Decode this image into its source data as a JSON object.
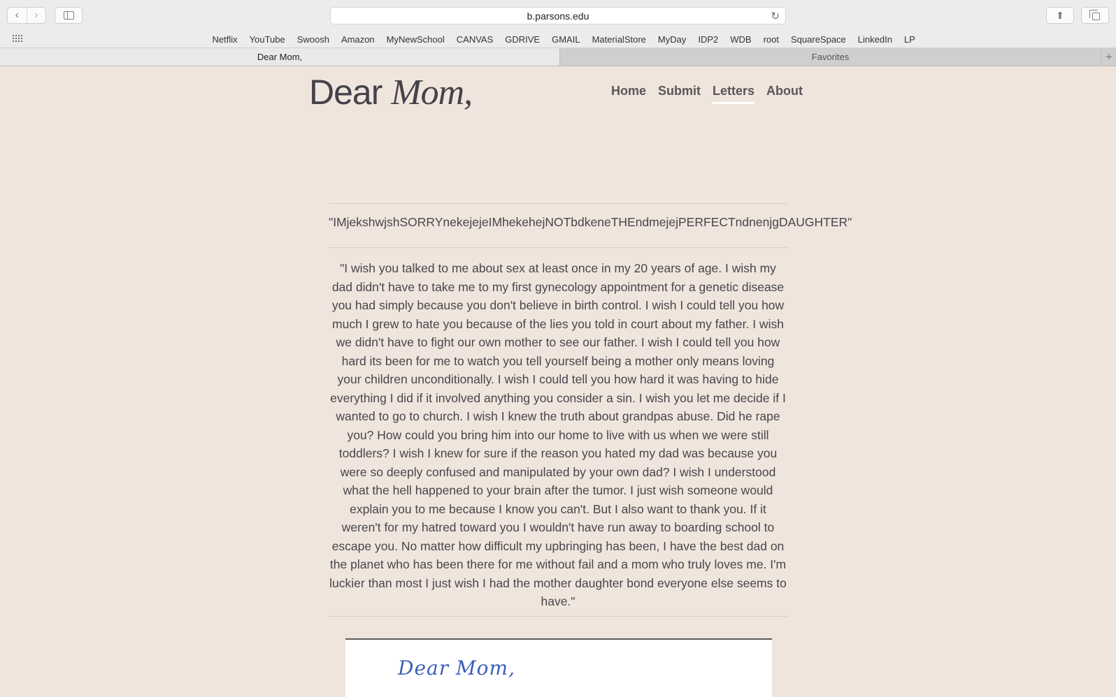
{
  "browser": {
    "url": "b.parsons.edu",
    "back_icon": "chevron-left-icon",
    "forward_icon": "chevron-right-icon",
    "bookmarks": [
      "Netflix",
      "YouTube",
      "Swoosh",
      "Amazon",
      "MyNewSchool",
      "CANVAS",
      "GDRIVE",
      "GMAIL",
      "MaterialStore",
      "MyDay",
      "IDP2",
      "WDB",
      "root",
      "SquareSpace",
      "LinkedIn",
      "LP"
    ],
    "tabs": {
      "active": "Dear Mom,",
      "inactive": "Favorites",
      "add": "+"
    }
  },
  "site": {
    "logo_part1": "Dear",
    "logo_part2": "Mom,",
    "nav": [
      {
        "label": "Home",
        "active": false
      },
      {
        "label": "Submit",
        "active": false
      },
      {
        "label": "Letters",
        "active": true
      },
      {
        "label": "About",
        "active": false
      }
    ]
  },
  "letter": {
    "title": "\"IMjekshwjshSORRYnekejejeIMhekehejNOTbdkeneTHEndmejejPERFECTndnenjgDAUGHTER\"",
    "body": "\"I wish you talked to me about sex at least once in my 20 years of age. I wish my dad didn't have to take me to my first gynecology appointment for a genetic disease you had simply because you don't believe in birth control. I wish I could tell you how much I grew to hate you because of the lies you told in court about my father. I wish we didn't have to fight our own mother to see our father. I wish I could tell you how hard its been for me to watch you tell yourself being a mother only means loving your children unconditionally. I wish I could tell you how hard it was having to hide everything I did if it involved anything you consider a sin. I wish you let me decide if I wanted to go to church. I wish I knew the truth about grandpas abuse. Did he rape you? How could you bring him into our home to live with us when we were still toddlers? I wish I knew for sure if the reason you hated my dad was because you were so deeply confused and manipulated by your own dad? I wish I understood what the hell happened to your brain after the tumor. I just wish someone would explain you to me because I know you can't. But I also want to thank you. If it weren't for my hatred toward you I wouldn't have run away to boarding school to escape you. No matter how difficult my upbringing has been, I have the best dad on the planet who has been there for me without fail and a mom who truly loves me. I'm luckier than most I just wish I had the mother daughter bond everyone else seems to have.\"",
    "scan_text": "Dear  Mom,"
  }
}
